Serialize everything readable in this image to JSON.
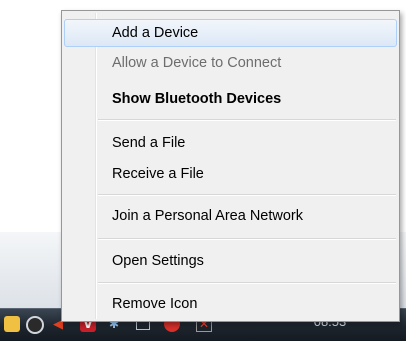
{
  "menu": {
    "items": [
      {
        "label": "Add a Device"
      },
      {
        "label": "Allow a Device to Connect"
      },
      {
        "label": "Show Bluetooth Devices"
      },
      {
        "label": "Send a File"
      },
      {
        "label": "Receive a File"
      },
      {
        "label": "Join a Personal Area Network"
      },
      {
        "label": "Open Settings"
      },
      {
        "label": "Remove Icon"
      }
    ]
  },
  "taskbar": {
    "clock": "08:53",
    "tray_icons": [
      "folder-icon",
      "speaker-icon",
      "flag-icon",
      "antivirus-icon",
      "bluetooth-icon",
      "network-icon",
      "security-icon",
      "action-center-icon"
    ]
  },
  "colors": {
    "menu_background": "#f0f0f0",
    "hover_border": "#aecff7",
    "taskbar": "#1d252e"
  }
}
